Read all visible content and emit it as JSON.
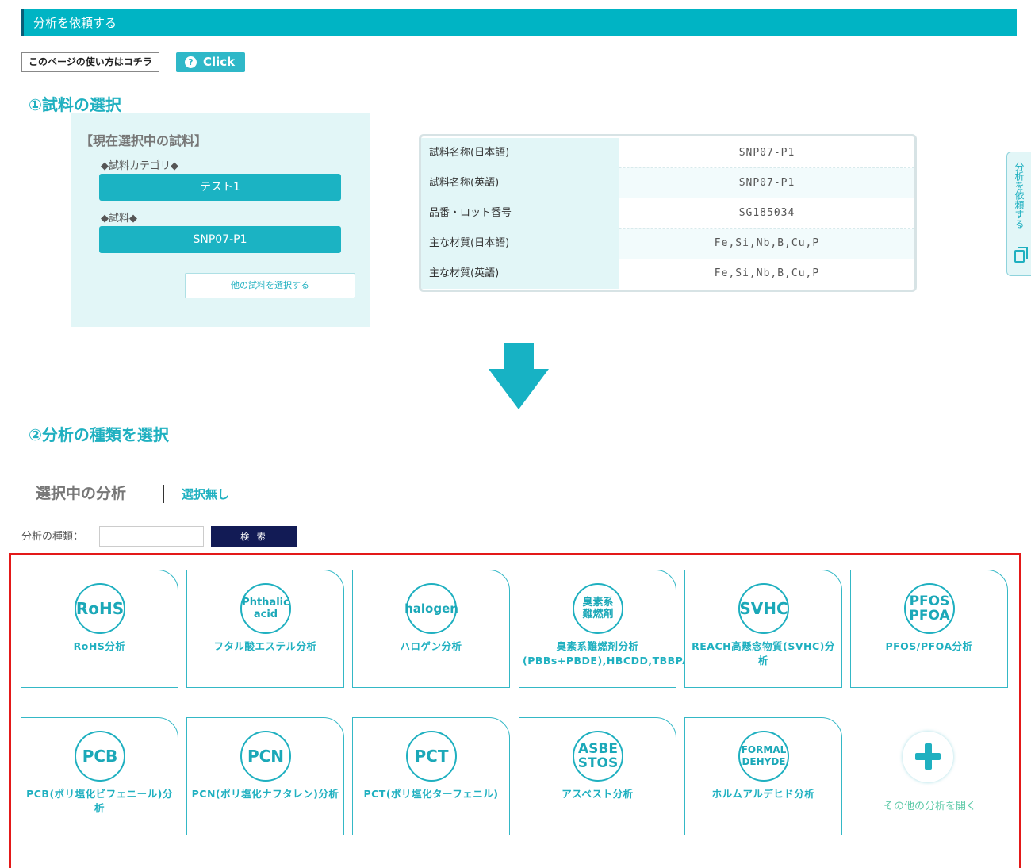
{
  "header": {
    "title": "分析を依頼する"
  },
  "help": {
    "howto_label": "このページの使い方はコチラ",
    "click_label": "Click",
    "click_icon": "question-icon"
  },
  "section1": {
    "title": "①試料の選択"
  },
  "current_sample": {
    "heading": "【現在選択中の試料】",
    "category_label": "◆試料カテゴリ◆",
    "category_value": "テスト1",
    "sample_label": "◆試料◆",
    "sample_value": "SNP07-P1",
    "other_button": "他の試料を選択する"
  },
  "sample_info": [
    {
      "key": "試料名称(日本語)",
      "value": "SNP07-P1"
    },
    {
      "key": "試料名称(英語)",
      "value": "SNP07-P1"
    },
    {
      "key": "品番・ロット番号",
      "value": "SG185034"
    },
    {
      "key": "主な材質(日本語)",
      "value": "Fe,Si,Nb,B,Cu,P"
    },
    {
      "key": "主な材質(英語)",
      "value": "Fe,Si,Nb,B,Cu,P"
    }
  ],
  "side_tab": {
    "label": "分析を依頼する",
    "icon": "document-copy-icon"
  },
  "section2": {
    "title": "②分析の種類を選択"
  },
  "selection": {
    "label": "選択中の分析",
    "value": "選択無し"
  },
  "search": {
    "label": "分析の種類：",
    "placeholder": "",
    "button": "検 索"
  },
  "analyses": [
    {
      "icon": [
        "RoHS"
      ],
      "label": "RoHS分析"
    },
    {
      "icon": [
        "Phthalic",
        "acid"
      ],
      "label": "フタル酸エステル分析"
    },
    {
      "icon": [
        "halogen"
      ],
      "label": "ハロゲン分析"
    },
    {
      "icon": [
        "臭素系",
        "難燃剤"
      ],
      "label": "臭素系難燃剤分析(PBBs+PBDE),HBCDD,TBBPA,TBP"
    },
    {
      "icon": [
        "SVHC"
      ],
      "label": "REACH高懸念物質(SVHC)分析"
    },
    {
      "icon": [
        "PFOS",
        "PFOA"
      ],
      "label": "PFOS/PFOA分析"
    },
    {
      "icon": [
        "PCB"
      ],
      "label": "PCB(ポリ塩化ビフェニール)分析"
    },
    {
      "icon": [
        "PCN"
      ],
      "label": "PCN(ポリ塩化ナフタレン)分析"
    },
    {
      "icon": [
        "PCT"
      ],
      "label": "PCT(ポリ塩化ターフェニル)"
    },
    {
      "icon": [
        "ASBE",
        "STOS"
      ],
      "label": "アスベスト分析"
    },
    {
      "icon": [
        "FORMAL",
        "DEHYDE"
      ],
      "label": "ホルムアルデヒド分析"
    }
  ],
  "more": {
    "label": "その他の分析を開く",
    "icon": "plus-icon"
  },
  "colors": {
    "accent": "#00b4c4",
    "search_button": "#121b55",
    "highlight_frame": "#e31919"
  }
}
